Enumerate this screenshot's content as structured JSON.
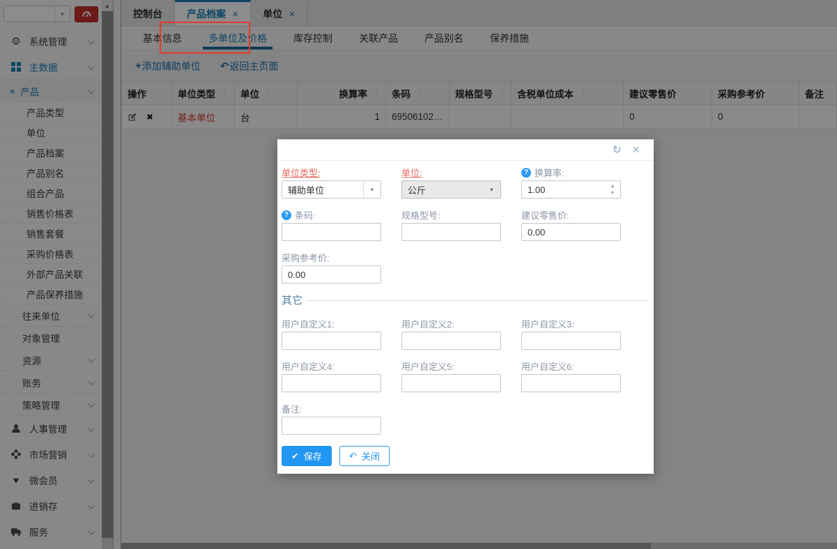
{
  "colors": {
    "accent": "#1b7eb8",
    "subtab_underline": "#1a6a9d",
    "dialog_primary": "#2196f3",
    "required_red": "#e8685f",
    "annotation_red": "#e6392c",
    "danger_button": "#c9302c",
    "unit_link_red": "#d43c35"
  },
  "sidebar": {
    "combo": {
      "value": ""
    },
    "items": [
      {
        "type": "group",
        "icon": "gears-icon",
        "label": "系统管理",
        "chevron": true
      },
      {
        "type": "group",
        "icon": "grid-icon",
        "label": "主数据",
        "chevron": true,
        "active": true
      },
      {
        "type": "subgroup",
        "icon": null,
        "label": "产品",
        "chevron": true,
        "active": true,
        "marker": "»"
      },
      {
        "type": "leaf",
        "icon": null,
        "label": "产品类型"
      },
      {
        "type": "leaf",
        "icon": null,
        "label": "单位"
      },
      {
        "type": "leaf",
        "icon": null,
        "label": "产品档案"
      },
      {
        "type": "leaf",
        "icon": null,
        "label": "产品别名"
      },
      {
        "type": "leaf",
        "icon": null,
        "label": "组合产品"
      },
      {
        "type": "leaf",
        "icon": null,
        "label": "销售价格表"
      },
      {
        "type": "leaf",
        "icon": null,
        "label": "销售套餐"
      },
      {
        "type": "leaf",
        "icon": null,
        "label": "采购价格表"
      },
      {
        "type": "leaf",
        "icon": null,
        "label": "外部产品关联"
      },
      {
        "type": "leaf",
        "icon": null,
        "label": "产品保养措施"
      },
      {
        "type": "subgroup",
        "icon": null,
        "label": "往来单位",
        "chevron": true
      },
      {
        "type": "subgroup",
        "icon": null,
        "label": "对象管理"
      },
      {
        "type": "subgroup",
        "icon": null,
        "label": "资源",
        "chevron": true
      },
      {
        "type": "subgroup",
        "icon": null,
        "label": "账务",
        "chevron": true
      },
      {
        "type": "subgroup",
        "icon": null,
        "label": "策略管理",
        "chevron": true
      },
      {
        "type": "group",
        "icon": "user-icon",
        "label": "人事管理",
        "chevron": true
      },
      {
        "type": "group",
        "icon": "segments-icon",
        "label": "市场营销",
        "chevron": true
      },
      {
        "type": "group",
        "icon": "heart-icon",
        "label": "微会员",
        "chevron": true
      },
      {
        "type": "group",
        "icon": "briefcase-icon",
        "label": "进销存",
        "chevron": true
      },
      {
        "type": "group",
        "icon": "truck-icon",
        "label": "服务",
        "chevron": true
      }
    ]
  },
  "tabs": [
    {
      "label": "控制台",
      "closable": false,
      "active": false
    },
    {
      "label": "产品档案",
      "closable": true,
      "active": true
    },
    {
      "label": "单位",
      "closable": true,
      "active": false
    }
  ],
  "subtabs": [
    {
      "label": "基本信息",
      "active": false
    },
    {
      "label": "多单位及价格",
      "active": true,
      "highlighted": true
    },
    {
      "label": "库存控制",
      "active": false
    },
    {
      "label": "关联产品",
      "active": false
    },
    {
      "label": "产品别名",
      "active": false
    },
    {
      "label": "保养措施",
      "active": false
    }
  ],
  "toolbar": {
    "add_label": "添加辅助单位",
    "back_label": "返回主页面"
  },
  "table": {
    "columns": [
      {
        "label": "操作"
      },
      {
        "label": "单位类型",
        "menu": true
      },
      {
        "label": "单位",
        "menu": true
      },
      {
        "label": "换算率",
        "menu": true,
        "align": "right"
      },
      {
        "label": "条码",
        "menu": true
      },
      {
        "label": "规格型号",
        "menu": true
      },
      {
        "label": "含税单位成本",
        "menu": true
      },
      {
        "label": "建议零售价"
      },
      {
        "label": "采购参考价"
      },
      {
        "label": "备注"
      }
    ],
    "rows": [
      {
        "unit_type": "基本单位",
        "unit": "台",
        "rate": "1",
        "barcode": "695061021...",
        "spec": "",
        "cost": "",
        "retail": "0",
        "purchase": "0",
        "note": ""
      }
    ]
  },
  "dialog": {
    "fields": {
      "unit_type": {
        "label": "单位类型:",
        "value": "辅助单位",
        "required": true
      },
      "unit": {
        "label": "单位:",
        "value": "公斤",
        "required": true,
        "focused": true
      },
      "rate": {
        "label": "换算率:",
        "value": "1.00",
        "help": true
      },
      "barcode": {
        "label": "条码:",
        "value": "",
        "help": true
      },
      "spec": {
        "label": "规格型号:",
        "value": ""
      },
      "retail": {
        "label": "建议零售价:",
        "value": "0.00"
      },
      "purchase": {
        "label": "采购参考价:",
        "value": "0.00"
      }
    },
    "section_title": "其它",
    "custom": {
      "c1": {
        "label": "用户自定义1:",
        "value": ""
      },
      "c2": {
        "label": "用户自定义2:",
        "value": ""
      },
      "c3": {
        "label": "用户自定义3:",
        "value": ""
      },
      "c4": {
        "label": "用户自定义4:",
        "value": ""
      },
      "c5": {
        "label": "用户自定义5:",
        "value": ""
      },
      "c6": {
        "label": "用户自定义6:",
        "value": ""
      }
    },
    "note": {
      "label": "备注:",
      "value": ""
    },
    "buttons": {
      "save": "保存",
      "close": "关闭"
    }
  }
}
